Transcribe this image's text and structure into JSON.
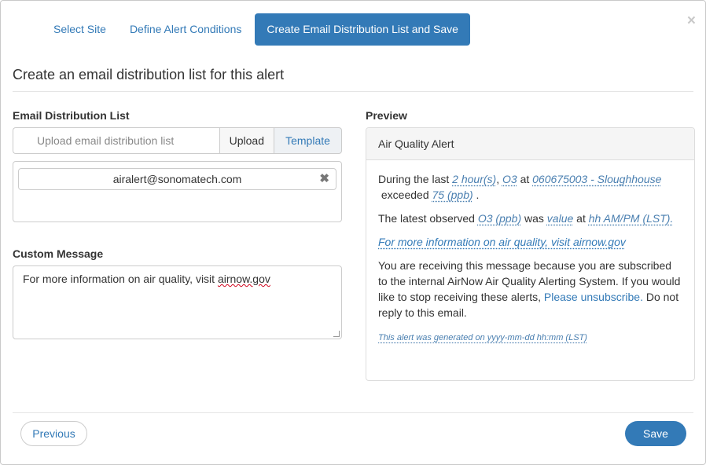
{
  "modal": {
    "close_glyph": "×"
  },
  "tabs": [
    {
      "label": "Select Site"
    },
    {
      "label": "Define Alert Conditions"
    },
    {
      "label": "Create Email Distribution List and Save"
    }
  ],
  "heading": "Create an email distribution list for this alert",
  "distribution": {
    "label": "Email Distribution List",
    "upload_placeholder": "Upload email distribution list",
    "upload_button": "Upload",
    "template_button": "Template",
    "emails": [
      {
        "address": "airalert@sonomatech.com",
        "remove_glyph": "✖"
      }
    ]
  },
  "custom_message": {
    "label": "Custom Message",
    "text_prefix": "For more information on air quality, visit ",
    "text_link": "airnow.gov"
  },
  "preview": {
    "label": "Preview",
    "panel_title": "Air Quality Alert",
    "p1": {
      "t1": "During the last",
      "hours": "2 hour(s)",
      "comma": ",",
      "pollutant": "O3",
      "at": "at",
      "site": "060675003 - Sloughhouse",
      "exceeded": "exceeded",
      "threshold": "75 (ppb)",
      "period": "."
    },
    "p2": {
      "t1": "The latest observed",
      "pollutant_unit": "O3 (ppb)",
      "was": "was",
      "value": "value",
      "at": "at",
      "time": "hh AM/PM (LST)."
    },
    "more_info_link": "For more information on air quality, visit airnow.gov",
    "p4": {
      "text": "You are receiving this message because you are subscribed to the internal AirNow Air Quality Alerting System. If you would like to stop receiving these alerts,",
      "unsubscribe": "Please unsubscribe.",
      "tail": "Do not reply to this email."
    },
    "generated": "This alert was generated on yyyy-mm-dd hh:mm (LST)"
  },
  "footer": {
    "previous": "Previous",
    "save": "Save"
  }
}
